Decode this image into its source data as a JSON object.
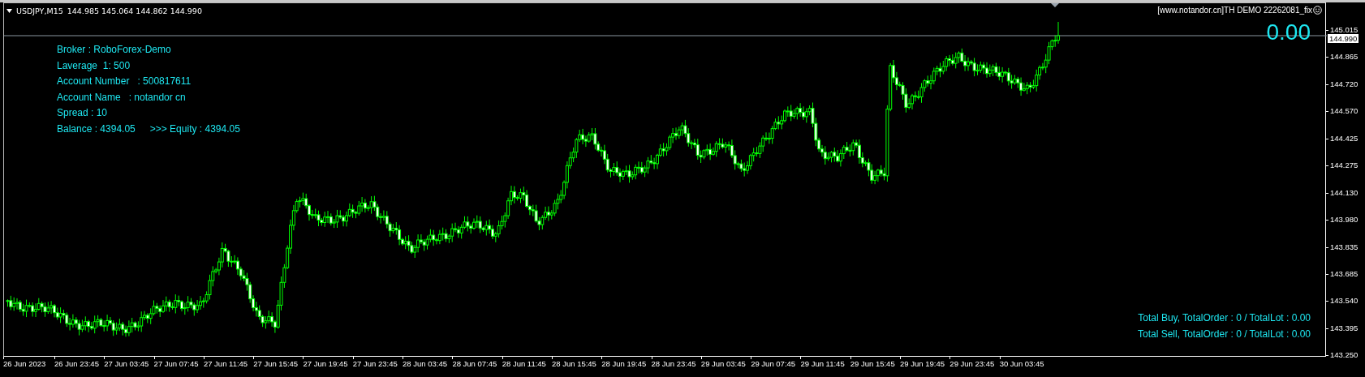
{
  "chart_header": {
    "symbol": "USDJPY,M15",
    "ohlc": "144.985 145.064 144.862 144.990"
  },
  "indicator_label": "[www.notandor.cn]TH DEMO 22262081_fix",
  "account_info": [
    "Broker : RoboForex-Demo",
    "Laverage  1: 500",
    "Account Number   : 500817611",
    "Account Name   : notandor cn",
    "Spread : 10"
  ],
  "balance": {
    "balance": "Balance : 4394.05",
    "equity": ">>> Equity : 4394.05"
  },
  "profit": "0.00",
  "order_totals": [
    "Total Buy, TotalOrder : 0 / TotalLot : 0.00",
    "Total Sell, TotalOrder : 0 / TotalLot : 0.00"
  ],
  "price_axis": {
    "current_price": "144.990",
    "ticks": [
      "145.015",
      "144.865",
      "144.720",
      "144.570",
      "144.425",
      "144.275",
      "144.130",
      "143.980",
      "143.835",
      "143.685",
      "143.540",
      "143.395",
      "143.250"
    ]
  },
  "time_axis": [
    "26 Jun 2023",
    "26 Jun 23:45",
    "27 Jun 03:45",
    "27 Jun 07:45",
    "27 Jun 11:45",
    "27 Jun 15:45",
    "27 Jun 19:45",
    "27 Jun 23:45",
    "28 Jun 03:45",
    "28 Jun 07:45",
    "28 Jun 11:45",
    "28 Jun 15:45",
    "28 Jun 19:45",
    "28 Jun 23:45",
    "29 Jun 03:45",
    "29 Jun 07:45",
    "29 Jun 11:45",
    "29 Jun 15:45",
    "29 Jun 19:45",
    "29 Jun 23:45",
    "30 Jun 03:45"
  ]
}
